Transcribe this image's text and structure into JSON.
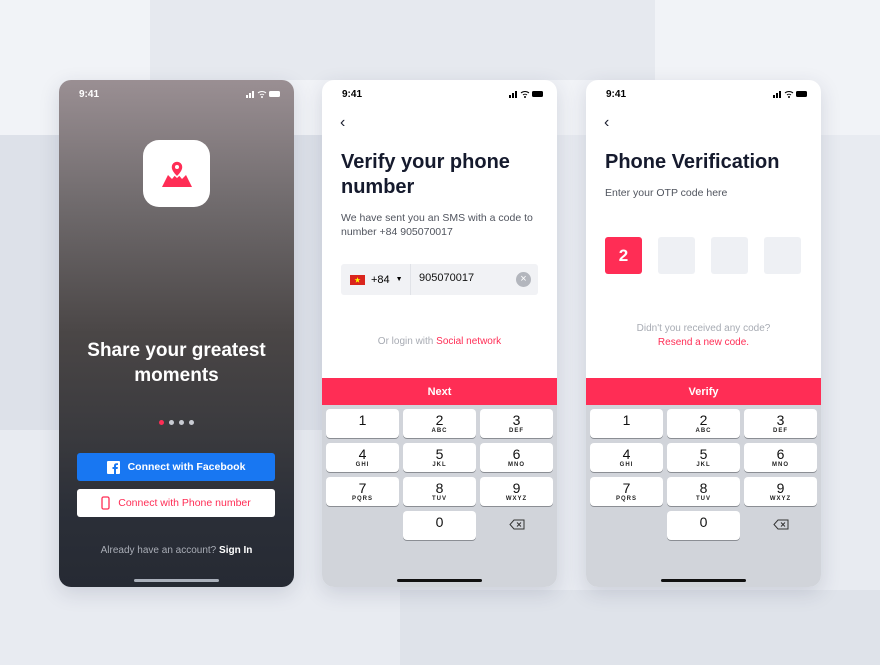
{
  "status_time": "9:41",
  "screen1": {
    "headline": "Share your greatest moments",
    "page_dots": 4,
    "active_dot": 0,
    "facebook_button": "Connect with Facebook",
    "phone_button": "Connect with Phone number",
    "signin_prompt": "Already have an account?",
    "signin_link": "Sign In"
  },
  "screen2": {
    "title": "Verify your phone number",
    "description": "We have sent you an SMS with a code to number +84 905070017",
    "country_code": "+84",
    "phone_value": "905070017",
    "alt_login_prefix": "Or login with",
    "alt_login_link": "Social network",
    "next_button": "Next"
  },
  "screen3": {
    "title": "Phone Verification",
    "subtitle": "Enter your OTP code here",
    "otp": [
      "2",
      "",
      "",
      ""
    ],
    "not_received": "Didn't you received any code?",
    "resend_link": "Resend a new code.",
    "verify_button": "Verify"
  },
  "keypad": [
    {
      "n": "1",
      "l": ""
    },
    {
      "n": "2",
      "l": "ABC"
    },
    {
      "n": "3",
      "l": "DEF"
    },
    {
      "n": "4",
      "l": "GHI"
    },
    {
      "n": "5",
      "l": "JKL"
    },
    {
      "n": "6",
      "l": "MNO"
    },
    {
      "n": "7",
      "l": "PQRS"
    },
    {
      "n": "8",
      "l": "TUV"
    },
    {
      "n": "9",
      "l": "WXYZ"
    },
    {
      "n": "0",
      "l": ""
    }
  ],
  "colors": {
    "accent": "#ff2d55",
    "facebook": "#1877f2",
    "title": "#151a2d"
  }
}
